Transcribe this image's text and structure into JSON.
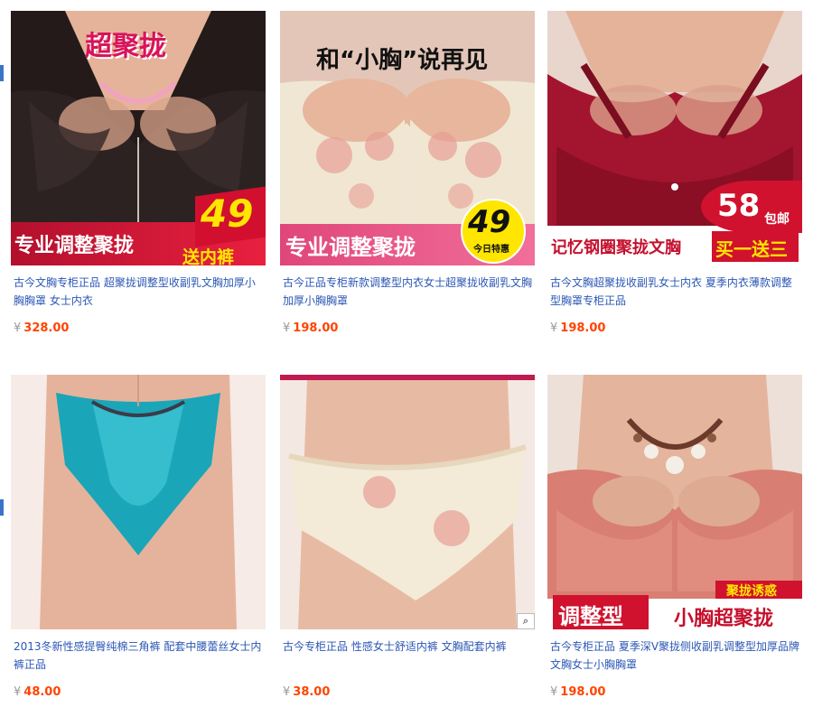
{
  "currency_symbol": "¥",
  "products": [
    {
      "title": "古今文胸专柜正品 超聚拢调整型收副乳文胸加厚小胸胸罩 女士内衣",
      "price": "328.00",
      "overlay_top": "超聚拢",
      "overlay_price": "49",
      "overlay_bottom": "专业调整聚拢",
      "overlay_badge": "送内裤"
    },
    {
      "title": "古今正品专柜新款调整型内衣女士超聚拢收副乳文胸加厚小胸胸罩",
      "price": "198.00",
      "overlay_top": "和“小胸”说再见",
      "overlay_price": "49",
      "overlay_price_sub": "今日特惠",
      "overlay_bottom": "专业调整聚拢"
    },
    {
      "title": "古今文胸超聚拢收副乳女士内衣 夏季内衣薄款调整型胸罩专柜正品",
      "price": "198.00",
      "overlay_price": "58",
      "overlay_price_sub": "包邮",
      "overlay_bottom": "记忆钢圈聚拢文胸",
      "overlay_badge": "买一送三"
    },
    {
      "title": "2013冬新性感提臀纯棉三角裤 配套中腰蕾丝女士内裤正品",
      "price": "48.00"
    },
    {
      "title": "古今专柜正品 性感女士舒适内裤 文胸配套内裤",
      "price": "38.00",
      "zoom_icon": "magnifier-icon"
    },
    {
      "title": "古今专柜正品 夏季深V聚拢侧收副乳调整型加厚品牌文胸女士小胸胸罩",
      "price": "198.00",
      "overlay_corner": "聚拢诱惑",
      "overlay_bottom_left": "调整型",
      "overlay_bottom_right": "小胸超聚拢"
    }
  ],
  "colors": {
    "link": "#2b57b5",
    "price": "#ff4400",
    "banner_red": "#d0143a",
    "banner_pink": "#e8357e",
    "badge_yellow": "#ffe600"
  }
}
